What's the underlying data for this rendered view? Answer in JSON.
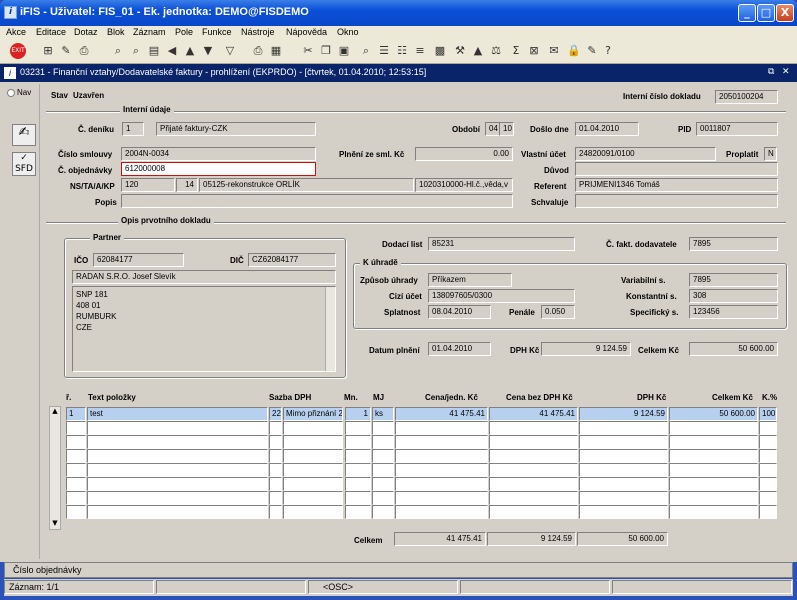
{
  "window": {
    "title": "iFIS - Uživatel: FIS_01 - Ek. jednotka: DEMO@FISDEMO",
    "min": "_",
    "max": "□",
    "close": "X"
  },
  "menu": [
    "Akce",
    "Editace",
    "Dotaz",
    "Blok",
    "Záznam",
    "Pole",
    "Funkce",
    "Nástroje",
    "Nápověda",
    "Okno"
  ],
  "form": {
    "title": "03231 - Finanční vztahy/Dodavatelské faktury - prohlížení (EKPRDO) - [čtvrtek, 01.04.2010; 12:53:15]"
  },
  "nav": {
    "label": "Nav",
    "sfd": "SFD"
  },
  "header": {
    "stav_label": "Stav",
    "stav_value": "Uzavřen",
    "interni_cislo_label": "Interní číslo dokladu",
    "interni_cislo_value": "2050100204"
  },
  "interni": {
    "title": "Interní údaje",
    "cislo_deniku_label": "Č. deníku",
    "cislo_deniku_value": "1",
    "cislo_deniku_name": "Přijaté faktury-CZK",
    "obdobi_label": "Období",
    "obdobi_value": "04",
    "obdobi_year": "10",
    "doslo_label": "Došlo dne",
    "doslo_value": "01.04.2010",
    "pid_label": "PID",
    "pid_value": "0011807",
    "smlouva_label": "Číslo smlouvy",
    "smlouva_value": "2004N-0034",
    "penize_label": "Plnění ze sml. Kč",
    "penize_value": "0.00",
    "vlastni_label": "Vlastní účet",
    "vlastni_value": "24820091/0100",
    "proplatit_label": "Proplatit",
    "proplatit_value": "N",
    "objednavka_label": "Č. objednávky",
    "objednavka_value": "612000008",
    "duvod_label": "Důvod",
    "duvod_value": "",
    "ns_label": "NS/TA/A/KP",
    "ns_value": "120",
    "ta_value": "14",
    "ta_name": "05125-rekonstrukce ORLÍK",
    "a_value": "1020310000-Hl.č.,věda,v",
    "referent_label": "Referent",
    "referent_value": "PRIJMENI1346 Tomáš",
    "popis_label": "Popis",
    "popis_value": "",
    "schvaluje_label": "Schvaluje",
    "schvaluje_value": ""
  },
  "opis": {
    "title": "Opis prvotního dokladu",
    "partner_title": "Partner",
    "ico_label": "IČO",
    "ico_value": "62084177",
    "dic_label": "DIČ",
    "dic_value": "CZ62084177",
    "name": "RADAN S.R.O. Josef Slevík",
    "addr1": "SNP 181",
    "addr2": "408 01",
    "addr3": "RUMBURK",
    "addr4": "CZE",
    "dodaci_label": "Dodací list",
    "dodaci_value": "85231",
    "fakt_label": "Č. fakt. dodavatele",
    "fakt_value": "7895",
    "kuhrade_title": "K úhradě",
    "zpusob_label": "Způsob úhrady",
    "zpusob_value": "Příkazem",
    "var_label": "Variabilní s.",
    "var_value": "7895",
    "cizi_label": "Cizí účet",
    "cizi_value": "138097605/0300",
    "konst_label": "Konstantní s.",
    "konst_value": "308",
    "splat_label": "Splatnost",
    "splat_value": "08.04.2010",
    "penale_label": "Penále",
    "penale_value": "0.050",
    "spec_label": "Specifický s.",
    "spec_value": "123456",
    "datum_label": "Datum plnění",
    "datum_value": "01.04.2010",
    "dph_label": "DPH Kč",
    "dph_value": "9 124.59",
    "celkem_label": "Celkem Kč",
    "celkem_value": "50 600.00"
  },
  "table": {
    "headers": [
      "ř.",
      "Text položky",
      "Sazba DPH",
      "Mn.",
      "MJ",
      "Cena/jedn. Kč",
      "Cena bez DPH Kč",
      "DPH Kč",
      "Celkem Kč",
      "K.%"
    ],
    "rows": [
      [
        "1",
        "test",
        "22",
        "Mimo přiznání 2",
        "1",
        "ks",
        "41 475.41",
        "41 475.41",
        "9 124.59",
        "50 600.00",
        "100"
      ]
    ],
    "total_label": "Celkem",
    "total_bez": "41 475.41",
    "total_dph": "9 124.59",
    "total_celkem": "50 600.00"
  },
  "status": {
    "hint": "Číslo objednávky",
    "record": "Záznam: 1/1",
    "osc": "<OSC>"
  }
}
